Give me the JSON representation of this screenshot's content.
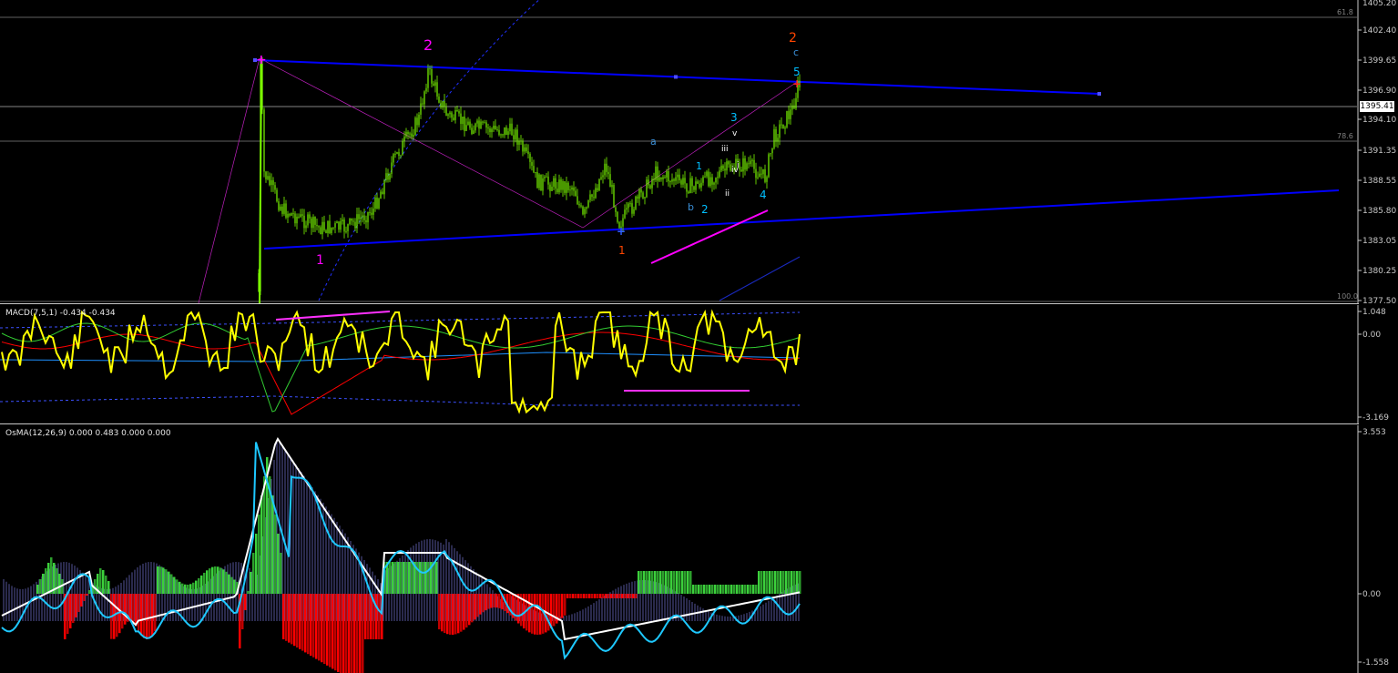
{
  "chart_data": [
    {
      "type": "candlestick",
      "pane": "main",
      "y_ticks": [
        "1402.40",
        "1399.65",
        "1396.90",
        "1394.10",
        "1391.35",
        "1388.55",
        "1385.80",
        "1383.05",
        "1380.25",
        "1377.50"
      ],
      "top_partial_tick": "1405.20",
      "current_price": "1395.41",
      "fib_levels": [
        {
          "label": "61.8"
        },
        {
          "label": "78.6"
        },
        {
          "label": "100.0"
        }
      ],
      "wave_labels": [
        {
          "text": "2",
          "color": "#ff00ff"
        },
        {
          "text": "1",
          "color": "#ff00ff"
        },
        {
          "text": "1",
          "color": "#ff4500"
        },
        {
          "text": "2",
          "color": "#ff4500"
        },
        {
          "text": "a",
          "color": "#3a8fd8"
        },
        {
          "text": "b",
          "color": "#3a8fd8"
        },
        {
          "text": "c",
          "color": "#3a8fd8"
        },
        {
          "text": "1",
          "color": "#00bfff"
        },
        {
          "text": "2",
          "color": "#00bfff"
        },
        {
          "text": "3",
          "color": "#00bfff"
        },
        {
          "text": "4",
          "color": "#00bfff"
        },
        {
          "text": "5",
          "color": "#00bfff"
        },
        {
          "text": "i",
          "color": "#ffffff"
        },
        {
          "text": "ii",
          "color": "#ffffff"
        },
        {
          "text": "iii",
          "color": "#ffffff"
        },
        {
          "text": "iv",
          "color": "#ffffff"
        },
        {
          "text": "v",
          "color": "#ffffff"
        }
      ]
    },
    {
      "type": "line",
      "pane": "macd",
      "title": "MACD(7,5,1) -0.434 -0.434",
      "y_ticks": [
        "1.048",
        "0.00",
        "-3.169"
      ]
    },
    {
      "type": "histogram",
      "pane": "osma",
      "title": "OsMA(12,26,9) 0.000 0.483 0.000 0.000",
      "y_ticks": [
        "3.553",
        "0.00",
        "-1.558"
      ]
    }
  ],
  "colors": {
    "background": "#000000",
    "candle": "#7cfc00",
    "trendline": "#0000ff",
    "fib": "#808080",
    "macd_main": "#ffff00",
    "macd_signal": "#ff0000",
    "macd_green": "#32cd32",
    "macd_blue": "#1e90ff",
    "osma_up": "#22bb22",
    "osma_down": "#ff0000",
    "osma_white": "#ffffff",
    "osma_cyan": "#1ec8ff"
  }
}
